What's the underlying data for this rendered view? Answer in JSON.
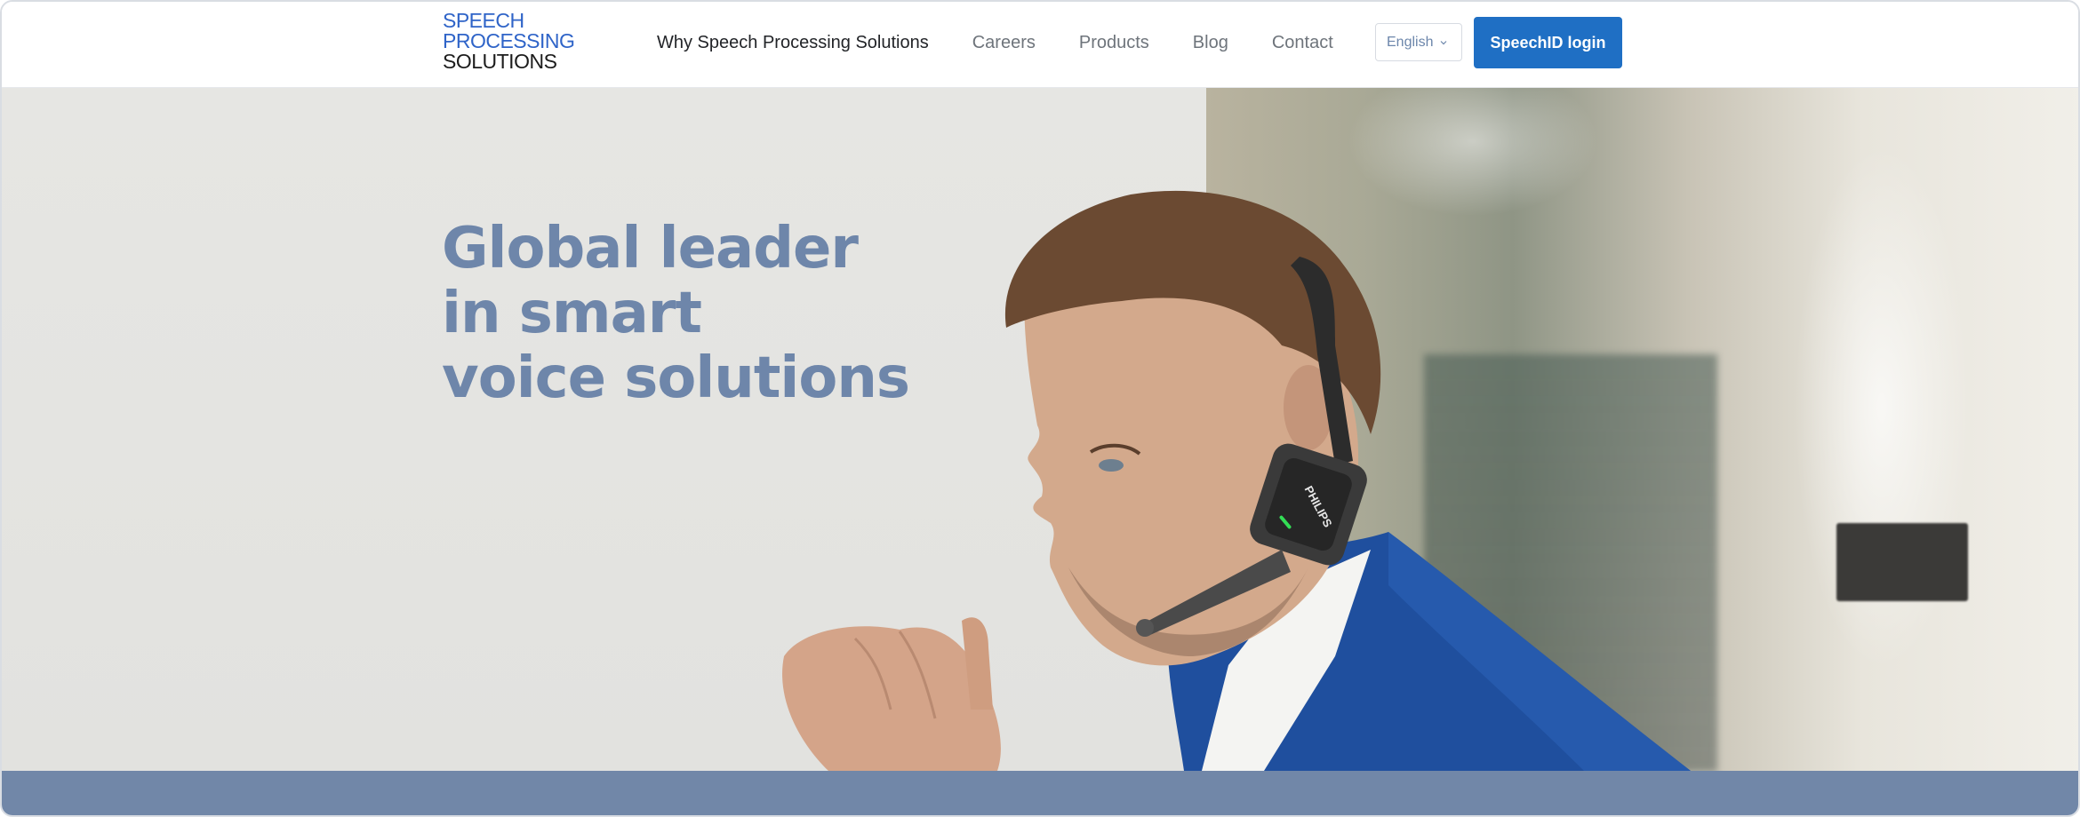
{
  "logo": {
    "line1": "SPEECH",
    "line2": "PROCESSING",
    "line3": "SOLUTIONS"
  },
  "nav": {
    "items": [
      {
        "label": "Why Speech Processing Solutions",
        "active": true
      },
      {
        "label": "Careers",
        "active": false
      },
      {
        "label": "Products",
        "active": false
      },
      {
        "label": "Blog",
        "active": false
      },
      {
        "label": "Contact",
        "active": false
      }
    ]
  },
  "language": {
    "selected": "English",
    "icon": "chevron-down-icon"
  },
  "login": {
    "label": "SpeechID login"
  },
  "hero": {
    "headline": [
      "Global leader",
      "in smart",
      "voice solutions"
    ],
    "headset_brand": "PHILIPS"
  },
  "colors": {
    "accent": "#1f6fc4",
    "logo_blue": "#2f64c8",
    "headline": "#6e86aa",
    "footer_bar": "#7187a8"
  }
}
